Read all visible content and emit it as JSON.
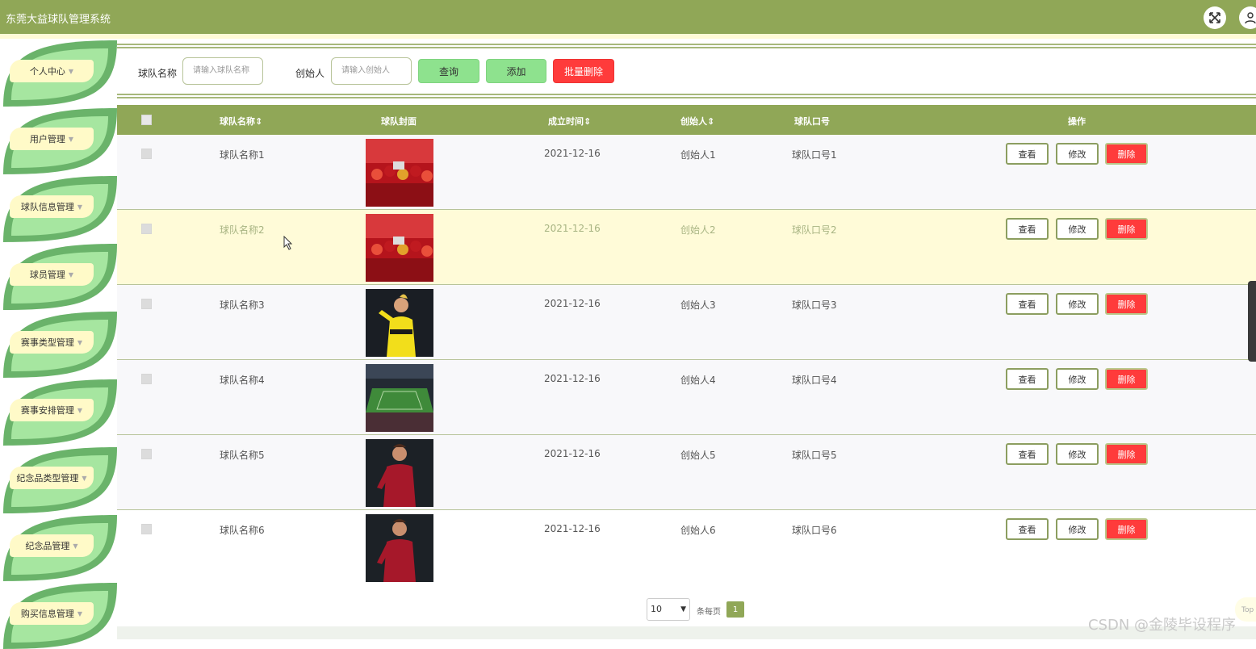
{
  "app": {
    "title": "东莞大益球队管理系统"
  },
  "sidebar": {
    "items": [
      {
        "label": "个人中心"
      },
      {
        "label": "用户管理"
      },
      {
        "label": "球队信息管理"
      },
      {
        "label": "球员管理"
      },
      {
        "label": "赛事类型管理"
      },
      {
        "label": "赛事安排管理"
      },
      {
        "label": "纪念品类型管理"
      },
      {
        "label": "纪念品管理"
      },
      {
        "label": "购买信息管理"
      }
    ]
  },
  "search": {
    "team_name_label": "球队名称",
    "team_name_placeholder": "请输入球队名称",
    "creator_label": "创始人",
    "creator_placeholder": "请输入创始人",
    "query_button": "查询",
    "add_button": "添加",
    "batch_delete_button": "批量删除"
  },
  "table": {
    "columns": [
      "球队名称",
      "球队封面",
      "成立时间",
      "创始人",
      "球队口号",
      "操作"
    ],
    "rows": [
      {
        "name": "球队名称1",
        "date": "2021-12-16",
        "creator": "创始人1",
        "slogan": "球队口号1",
        "cover": "team-celebration"
      },
      {
        "name": "球队名称2",
        "date": "2021-12-16",
        "creator": "创始人2",
        "slogan": "球队口号2",
        "cover": "team-celebration"
      },
      {
        "name": "球队名称3",
        "date": "2021-12-16",
        "creator": "创始人3",
        "slogan": "球队口号3",
        "cover": "player-yellow-kit"
      },
      {
        "name": "球队名称4",
        "date": "2021-12-16",
        "creator": "创始人4",
        "slogan": "球队口号4",
        "cover": "stadium"
      },
      {
        "name": "球队名称5",
        "date": "2021-12-16",
        "creator": "创始人5",
        "slogan": "球队口号5",
        "cover": "player-red-kit"
      },
      {
        "name": "球队名称6",
        "date": "2021-12-16",
        "creator": "创始人6",
        "slogan": "球队口号6",
        "cover": "player-red-kit"
      }
    ],
    "actions": {
      "view": "查看",
      "edit": "修改",
      "delete": "删除"
    }
  },
  "pagination": {
    "page_size": "10",
    "per_page_label": "条每页",
    "current_page": "1"
  },
  "misc": {
    "to_top": "Top",
    "watermark": "CSDN @金陵毕设程序"
  },
  "colors": {
    "header": "#90a757",
    "menu_dark": "#6ab36a",
    "menu_light": "#a6e6a0",
    "menu_label": "#fffac8",
    "green_button": "#8ee28e",
    "red_button": "#ff3b3b",
    "highlight_row": "#fffbd8"
  }
}
